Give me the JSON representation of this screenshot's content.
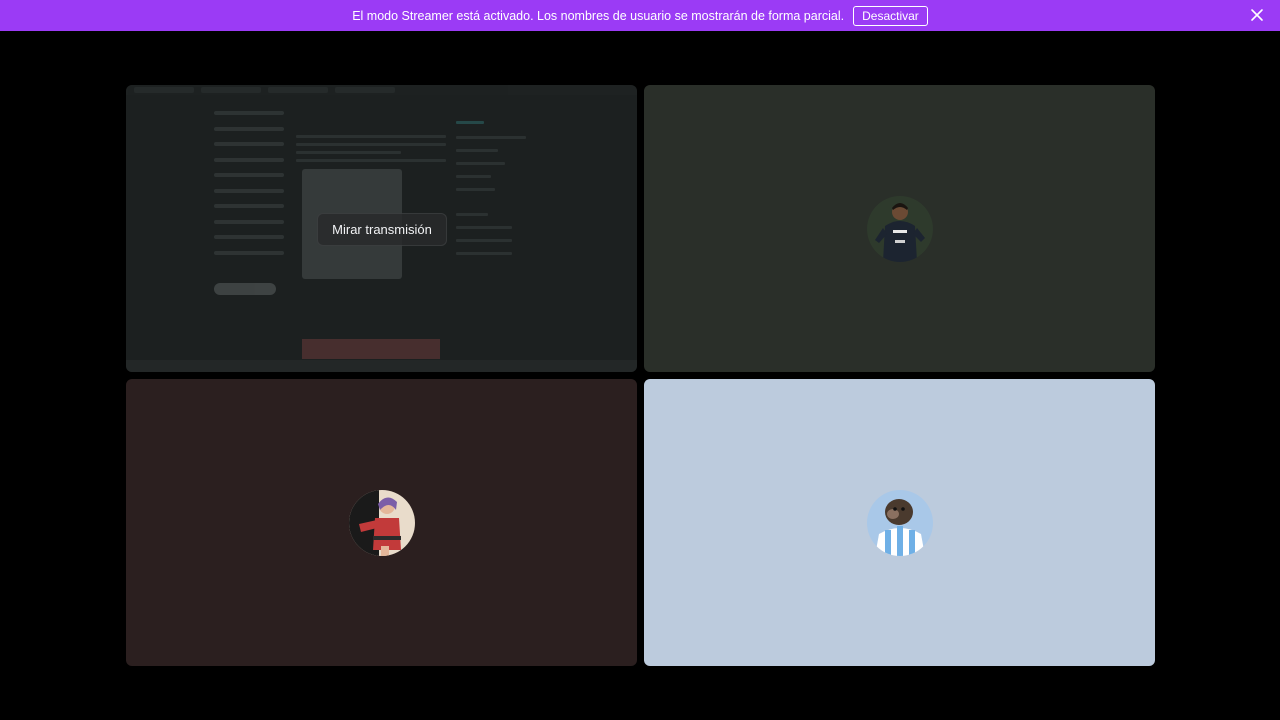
{
  "notice": {
    "message": "El modo Streamer está activado. Los nombres de usuario se mostrarán de forma parcial.",
    "button_label": "Desactivar",
    "background_color": "#9b3bf5"
  },
  "tiles": [
    {
      "type": "stream",
      "watch_label": "Mirar transmisión",
      "background_color": "#1c2020"
    },
    {
      "type": "avatar",
      "icon": "user-avatar-football-player",
      "background_color": "#2a2f29"
    },
    {
      "type": "avatar",
      "icon": "user-avatar-cartoon-character",
      "background_color": "#2b1f1f"
    },
    {
      "type": "avatar",
      "icon": "user-avatar-monkey-jersey",
      "background_color": "#bccbdd"
    }
  ]
}
